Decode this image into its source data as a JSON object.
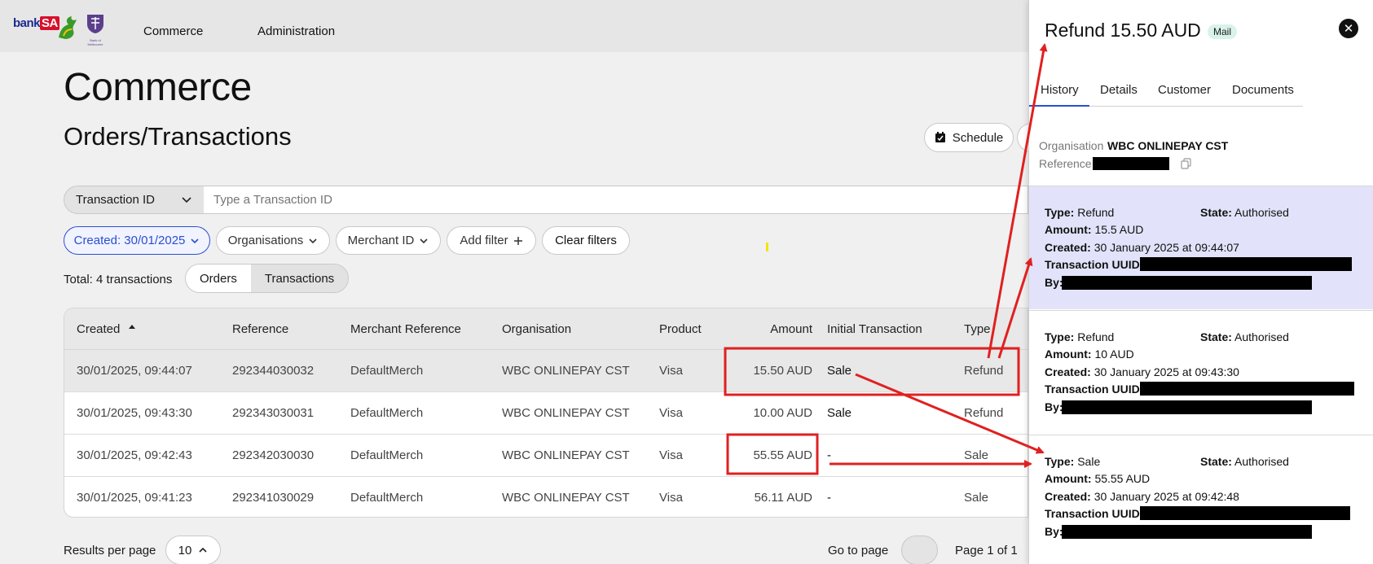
{
  "brand": {
    "name_prefix": "bank",
    "name_suffix": "SA",
    "crest_text": "Bank of Melbourne"
  },
  "nav": {
    "commerce": "Commerce",
    "administration": "Administration"
  },
  "page": {
    "title": "Commerce",
    "subtitle": "Orders/Transactions",
    "schedule_label": "Schedule"
  },
  "search": {
    "field_label": "Transaction ID",
    "placeholder": "Type a Transaction ID"
  },
  "filters": {
    "created": "Created: 30/01/2025",
    "organisations": "Organisations",
    "merchant_id": "Merchant ID",
    "add_filter": "Add filter",
    "clear_filters": "Clear filters"
  },
  "summary": {
    "total": "Total: 4 transactions",
    "view_orders": "Orders",
    "view_transactions": "Transactions"
  },
  "table": {
    "columns": [
      "Created",
      "Reference",
      "Merchant Reference",
      "Organisation",
      "Product",
      "Amount",
      "Initial Transaction",
      "Type"
    ],
    "rows": [
      [
        "30/01/2025, 09:44:07",
        "292344030032",
        "DefaultMerch",
        "WBC ONLINEPAY CST",
        "Visa",
        "15.50 AUD",
        "Sale",
        "Refund"
      ],
      [
        "30/01/2025, 09:43:30",
        "292343030031",
        "DefaultMerch",
        "WBC ONLINEPAY CST",
        "Visa",
        "10.00 AUD",
        "Sale",
        "Refund"
      ],
      [
        "30/01/2025, 09:42:43",
        "292342030030",
        "DefaultMerch",
        "WBC ONLINEPAY CST",
        "Visa",
        "55.55 AUD",
        "-",
        "Sale"
      ],
      [
        "30/01/2025, 09:41:23",
        "292341030029",
        "DefaultMerch",
        "WBC ONLINEPAY CST",
        "Visa",
        "56.11 AUD",
        "-",
        "Sale"
      ]
    ]
  },
  "pagination": {
    "results_per_page_label": "Results per page",
    "results_per_page": "10",
    "go_to_page_label": "Go to page",
    "page_of": "Page 1 of 1"
  },
  "panel": {
    "title": "Refund 15.50 AUD",
    "badge": "Mail",
    "tabs": [
      "History",
      "Details",
      "Customer",
      "Documents"
    ],
    "organisation_label": "Organisation",
    "organisation_value": "WBC ONLINEPAY CST",
    "reference_label": "Reference",
    "labels": {
      "type": "Type:",
      "state": "State:",
      "amount": "Amount:",
      "created": "Created:",
      "uuid": "Transaction UUID:",
      "by": "By:"
    },
    "history": [
      {
        "type": "Refund",
        "state": "Authorised",
        "amount": "15.5 AUD",
        "created": "30 January 2025 at 09:44:07"
      },
      {
        "type": "Refund",
        "state": "Authorised",
        "amount": "10 AUD",
        "created": "30 January 2025 at 09:43:30"
      },
      {
        "type": "Sale",
        "state": "Authorised",
        "amount": "55.55 AUD",
        "created": "30 January 2025 at 09:42:48"
      }
    ]
  },
  "colors": {
    "accent": "#2a4fd0",
    "annotation": "#e02020",
    "highlight": "#e2e3fa"
  }
}
